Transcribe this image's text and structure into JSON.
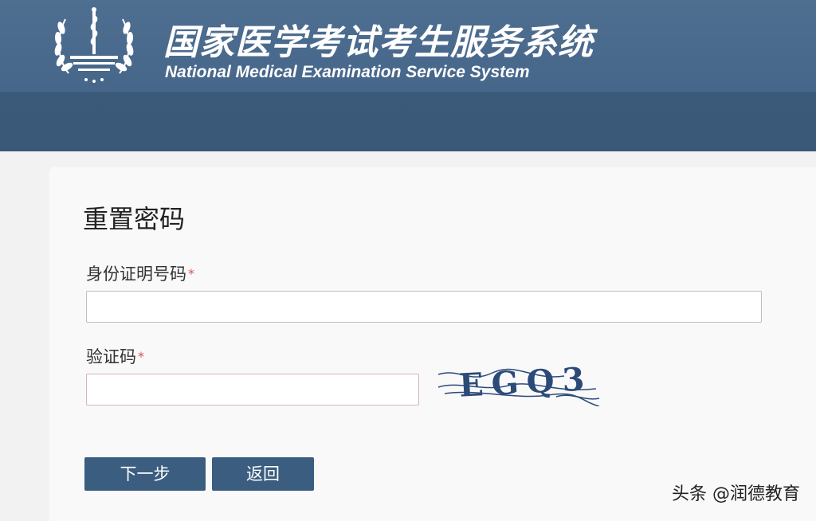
{
  "header": {
    "title_cn": "国家医学考试考生服务系统",
    "title_en": "National Medical Examination Service System"
  },
  "page": {
    "heading": "重置密码"
  },
  "form": {
    "id_label": "身份证明号码",
    "id_value": "",
    "captcha_label": "验证码",
    "captcha_value": "",
    "required_mark": "*",
    "captcha_image_text": "EGQ3"
  },
  "buttons": {
    "next": "下一步",
    "back": "返回"
  },
  "watermark": "头条 @润德教育",
  "colors": {
    "header_bg": "#46668a",
    "button_bg": "#3b5d80",
    "required": "#e05050"
  }
}
